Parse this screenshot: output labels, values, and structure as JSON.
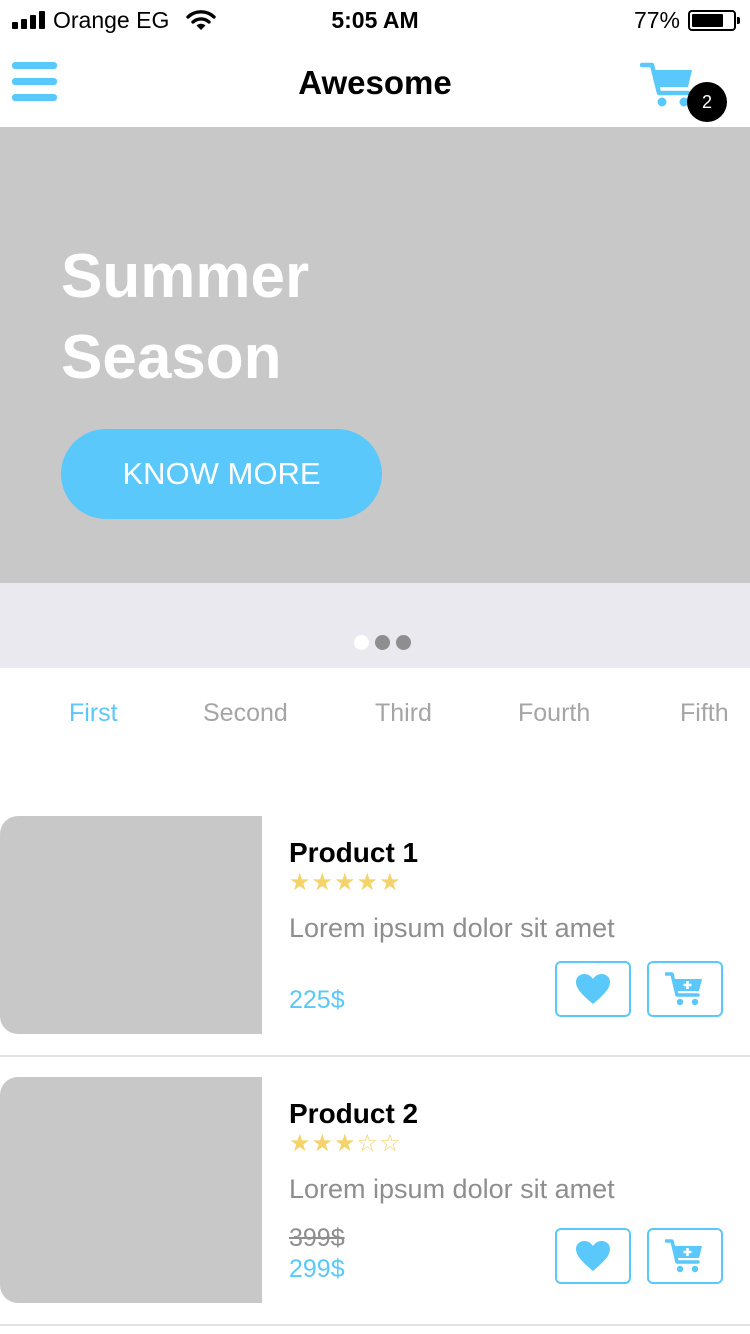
{
  "status_bar": {
    "carrier": "Orange EG",
    "time": "5:05 AM",
    "battery_percent": "77%",
    "battery_level": 0.77,
    "icons": [
      "signal-bars-icon",
      "wifi-icon",
      "battery-icon"
    ]
  },
  "nav": {
    "title": "Awesome",
    "cart_count": "2",
    "icons": [
      "menu-icon",
      "cart-icon"
    ]
  },
  "colors": {
    "accent": "#5ac8fa",
    "placeholder": "#c8c8c8",
    "star": "#f5d36b",
    "muted_text": "#8e8e8e"
  },
  "hero": {
    "title_line1": "Summer",
    "title_line2": "Season",
    "button_label": "KNOW MORE",
    "slide_count": 3,
    "active_slide": 1
  },
  "tabs": [
    {
      "label": "First",
      "active": true
    },
    {
      "label": "Second",
      "active": false
    },
    {
      "label": "Third",
      "active": false
    },
    {
      "label": "Fourth",
      "active": false
    },
    {
      "label": "Fifth",
      "active": false
    }
  ],
  "products": [
    {
      "name": "Product 1",
      "stars": "★★★★★",
      "rating": 5,
      "description": "Lorem ipsum dolor sit amet",
      "price": "225$",
      "old_price": null
    },
    {
      "name": "Product 2",
      "stars": "★★★☆☆",
      "rating": 3,
      "description": "Lorem ipsum dolor sit amet",
      "price": "299$",
      "old_price": "399$"
    }
  ]
}
